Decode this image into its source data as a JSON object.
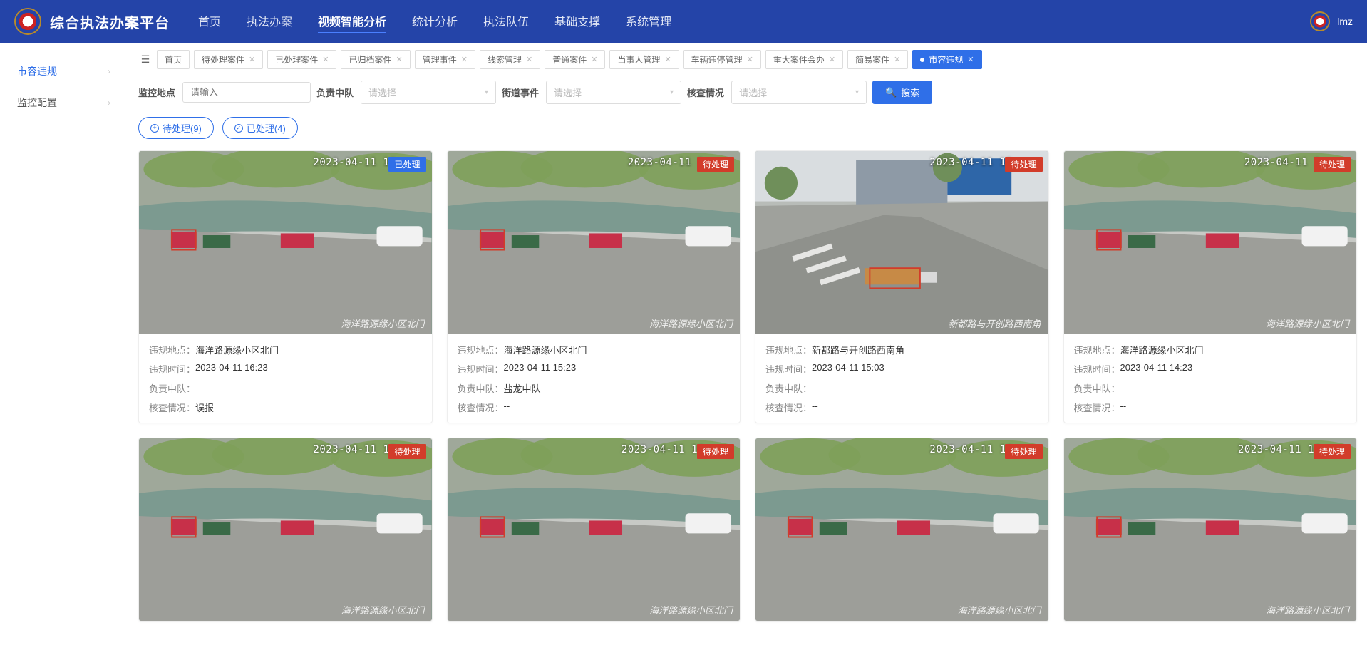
{
  "app_title": "综合执法办案平台",
  "user": "lmz",
  "top_nav": [
    "首页",
    "执法办案",
    "视频智能分析",
    "统计分析",
    "执法队伍",
    "基础支撑",
    "系统管理"
  ],
  "top_nav_active": 2,
  "sidebar": [
    {
      "label": "市容违规",
      "active": true
    },
    {
      "label": "监控配置",
      "active": false
    }
  ],
  "tabs": [
    {
      "label": "首页",
      "closable": false
    },
    {
      "label": "待处理案件",
      "closable": true
    },
    {
      "label": "已处理案件",
      "closable": true
    },
    {
      "label": "已归档案件",
      "closable": true
    },
    {
      "label": "管理事件",
      "closable": true
    },
    {
      "label": "线索管理",
      "closable": true
    },
    {
      "label": "普通案件",
      "closable": true
    },
    {
      "label": "当事人管理",
      "closable": true
    },
    {
      "label": "车辆违停管理",
      "closable": true
    },
    {
      "label": "重大案件会办",
      "closable": true
    },
    {
      "label": "简易案件",
      "closable": true
    },
    {
      "label": "市容违规",
      "closable": true,
      "active": true
    }
  ],
  "filters": {
    "location_label": "监控地点",
    "location_placeholder": "请输入",
    "team_label": "负责中队",
    "team_placeholder": "请选择",
    "street_label": "街道事件",
    "street_placeholder": "请选择",
    "check_label": "核查情况",
    "check_placeholder": "请选择",
    "search_label": "搜索"
  },
  "status_filters": {
    "pending": "待处理(9)",
    "done": "已处理(4)"
  },
  "cards": [
    {
      "timestamp_overlay": "2023-04-11 16",
      "status": "done",
      "status_label": "已处理",
      "overlay_loc": "海洋路源缘小区北门",
      "location": "海洋路源缘小区北门",
      "time": "2023-04-11 16:23",
      "team": "",
      "check": "误报",
      "scene": "riverside"
    },
    {
      "timestamp_overlay": "2023-04-11 1",
      "status": "pending",
      "status_label": "待处理",
      "overlay_loc": "海洋路源缘小区北门",
      "location": "海洋路源缘小区北门",
      "time": "2023-04-11 15:23",
      "team": "盐龙中队",
      "check": "--",
      "scene": "riverside"
    },
    {
      "timestamp_overlay": "2023-04-11 15",
      "status": "pending",
      "status_label": "待处理",
      "overlay_loc": "新都路与开创路西南角",
      "location": "新都路与开创路西南角",
      "time": "2023-04-11 15:03",
      "team": "",
      "check": "--",
      "scene": "intersection"
    },
    {
      "timestamp_overlay": "2023-04-11 1",
      "status": "pending",
      "status_label": "待处理",
      "overlay_loc": "海洋路源缘小区北门",
      "location": "海洋路源缘小区北门",
      "time": "2023-04-11 14:23",
      "team": "",
      "check": "--",
      "scene": "riverside"
    },
    {
      "timestamp_overlay": "2023-04-11 16",
      "status": "pending",
      "status_label": "待处理",
      "overlay_loc": "海洋路源缘小区北门",
      "scene": "riverside"
    },
    {
      "timestamp_overlay": "2023-04-11 16",
      "status": "pending",
      "status_label": "待处理",
      "overlay_loc": "海洋路源缘小区北门",
      "scene": "riverside"
    },
    {
      "timestamp_overlay": "2023-04-11 16",
      "status": "pending",
      "status_label": "待处理",
      "overlay_loc": "海洋路源缘小区北门",
      "scene": "riverside"
    },
    {
      "timestamp_overlay": "2023-04-11 16",
      "status": "pending",
      "status_label": "待处理",
      "overlay_loc": "海洋路源缘小区北门",
      "scene": "riverside"
    }
  ],
  "card_field_labels": {
    "location": "违规地点",
    "time": "违规时间",
    "team": "负责中队",
    "check": "核查情况"
  }
}
